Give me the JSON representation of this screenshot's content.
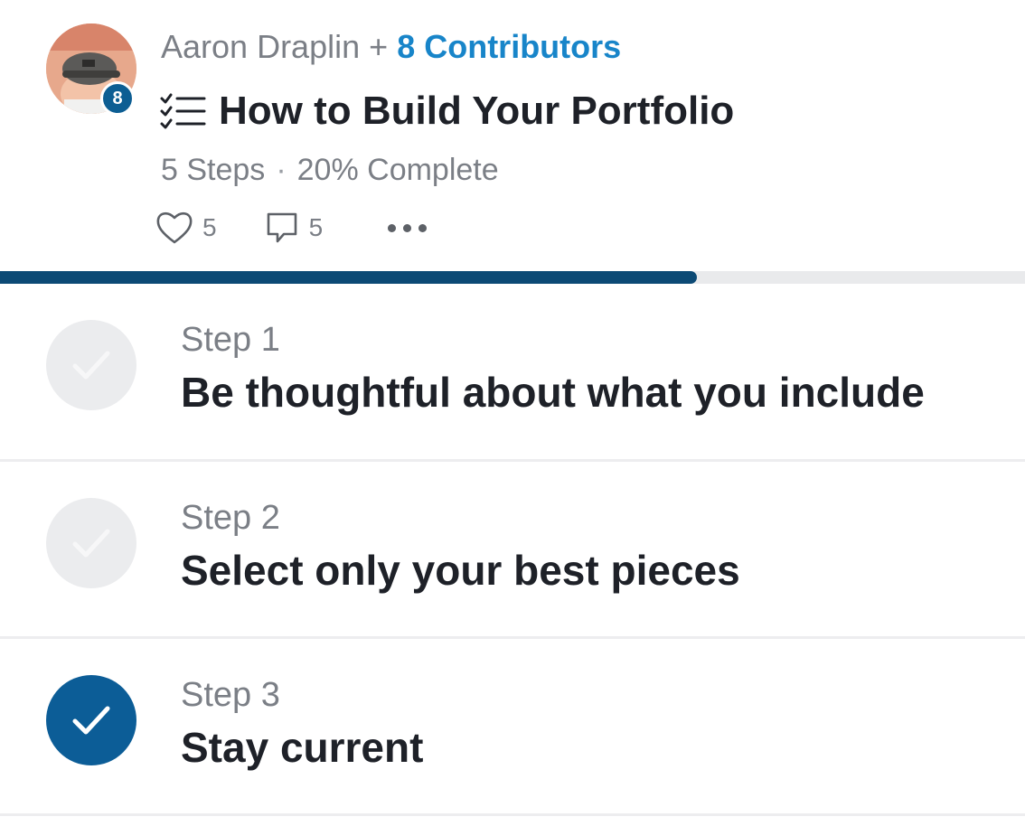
{
  "card": {
    "author": "Aaron Draplin",
    "plus": "+",
    "contributors_label": "8 Contributors",
    "avatar_badge": "8",
    "list_icon": "checklist-icon",
    "title": "How to Build Your Portfolio",
    "steps_count": "5 Steps",
    "separator": "·",
    "complete_label": "20% Complete",
    "likes": "5",
    "comments": "5",
    "more_icon": "ellipsis-icon"
  },
  "progress": {
    "fraction": 0.68,
    "fill_color": "#0c4a75",
    "track_color": "#e9eaec"
  },
  "steps": [
    {
      "label": "Step 1",
      "title": "Be thoughtful about what you include",
      "completed": false
    },
    {
      "label": "Step 2",
      "title": "Select only your best pieces",
      "completed": false
    },
    {
      "label": "Step 3",
      "title": "Stay current",
      "completed": true
    }
  ],
  "colors": {
    "accent": "#1885c9",
    "check_done": "#0c5d97",
    "check_pending": "#ebecee",
    "text_primary": "#1e2128",
    "text_secondary": "#7b7f86"
  }
}
